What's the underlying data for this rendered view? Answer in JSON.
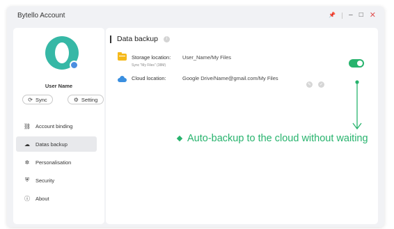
{
  "window": {
    "title": "Bytello Account",
    "controls": {
      "pin": "📌",
      "minimize": "–",
      "maximize": "□",
      "close": "✕"
    }
  },
  "profile": {
    "username": "User Name",
    "sync_label": "Sync",
    "setting_label": "Setting"
  },
  "sidebar": {
    "items": [
      {
        "label": "Account binding",
        "icon": "link-icon",
        "glyph": "⛓"
      },
      {
        "label": "Datas backup",
        "icon": "cloud-upload-icon",
        "glyph": "☁"
      },
      {
        "label": "Personalisation",
        "icon": "palette-icon",
        "glyph": "✲"
      },
      {
        "label": "Security",
        "icon": "shield-icon",
        "glyph": "⛨"
      },
      {
        "label": "About",
        "icon": "info-icon",
        "glyph": "ⓘ"
      }
    ],
    "active_index": 1
  },
  "main": {
    "section_title": "Data backup",
    "storage": {
      "label": "Storage location:",
      "value": "User_Name/My Files",
      "sub": "Sync \"My Files\" (38M)",
      "toggle_on": true
    },
    "cloud": {
      "label": "Cloud location:",
      "value": "Google Drive/Name@gmail.com/My Files"
    }
  },
  "callout": {
    "text": "Auto-backup to the cloud without waiting"
  },
  "colors": {
    "accent": "#27b36d",
    "avatar": "#36b8a6",
    "folder": "#f5b91a",
    "cloud": "#3a8fe0"
  }
}
